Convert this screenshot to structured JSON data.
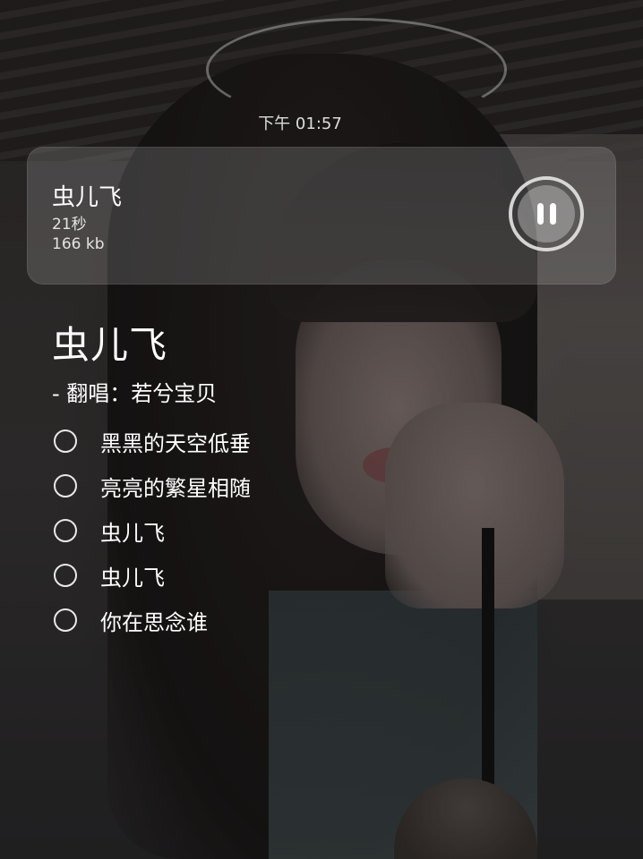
{
  "status_bar": {
    "time": "下午 01:57"
  },
  "player": {
    "title": "虫儿飞",
    "duration": "21秒",
    "size": "166 kb",
    "state_icon": "pause-icon"
  },
  "song": {
    "heading": "虫儿飞",
    "credit": "-  翻唱：若兮宝贝",
    "lyrics": [
      "黑黑的天空低垂",
      "亮亮的繁星相随",
      "虫儿飞",
      "虫儿飞",
      "你在思念谁"
    ]
  },
  "colors": {
    "text": "#ffffff",
    "card_overlay": "#bebebe"
  }
}
